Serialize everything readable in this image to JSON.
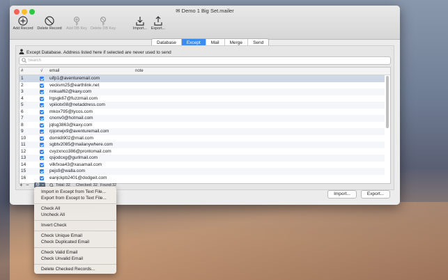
{
  "window": {
    "title": "Demo 1 Big Set.mailer"
  },
  "toolbar": {
    "add_record": "Add Record",
    "delete_record": "Delete Record",
    "add_db_key": "Add DB Key",
    "delete_db_key": "Delete DB Key",
    "import": "Import...",
    "export": "Export..."
  },
  "tabs": [
    "Database",
    "Except",
    "Mail",
    "Merge",
    "Send"
  ],
  "active_tab": "Except",
  "info_text": "Except Database. Address listed here if selected are never used to send",
  "search": {
    "placeholder": "Search",
    "value": ""
  },
  "table": {
    "columns": {
      "num": "#",
      "check": "√",
      "email": "email",
      "note": "note"
    },
    "rows": [
      {
        "n": "1",
        "email": "uifp1@aventuremail.com"
      },
      {
        "n": "2",
        "email": "veckvm25@earthlink.net"
      },
      {
        "n": "3",
        "email": "nnkuaf62@kaxy.com"
      },
      {
        "n": "4",
        "email": "lrgsgk67@fuzzmail.com"
      },
      {
        "n": "5",
        "email": "vpiiiotx08@netaddress.com"
      },
      {
        "n": "6",
        "email": "mkox795@lycos.com"
      },
      {
        "n": "7",
        "email": "cnonv0@hotmail.com"
      },
      {
        "n": "8",
        "email": "jqlsg3863@kaxy.com"
      },
      {
        "n": "9",
        "email": "rpjonwjx9@aventuremail.com"
      },
      {
        "n": "10",
        "email": "domk8902@mail.com"
      },
      {
        "n": "11",
        "email": "sgbtv2085@mailanywhere.com"
      },
      {
        "n": "12",
        "email": "cvyzxnco386@prontomail.com"
      },
      {
        "n": "13",
        "email": "qsjodcxg@gurlmail.com"
      },
      {
        "n": "14",
        "email": "vilkfxoa43@xasamail.com"
      },
      {
        "n": "15",
        "email": "pejs9@walla.com"
      },
      {
        "n": "16",
        "email": "eanjckpb2401@dodgeit.com"
      }
    ]
  },
  "footer": {
    "plus": "+",
    "minus": "−",
    "caret": "⌄",
    "total": "Total: 32",
    "checked": "Checked: 32",
    "found": "Found:32"
  },
  "buttons": {
    "import": "Import...",
    "export": "Export..."
  },
  "context_menu": [
    "Import in Except from Text File...",
    "Export from Except to Text File...",
    "Check All",
    "Uncheck All",
    "Invert Check",
    "Check Unique Email",
    "Check Duplicated Email",
    "Check Valid  Email",
    "Check Unvalid  Email",
    "Delete Checked Records..."
  ]
}
